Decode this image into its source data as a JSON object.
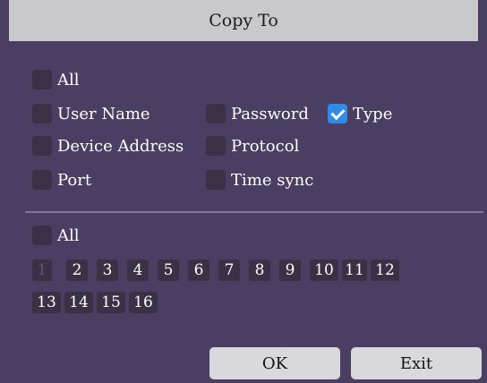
{
  "dialog": {
    "title": "Copy To"
  },
  "fields": {
    "all_label": "All",
    "user_name": "User Name",
    "password": "Password",
    "type": "Type",
    "device_address": "Device Address",
    "protocol": "Protocol",
    "port": "Port",
    "time_sync": "Time sync"
  },
  "channels": {
    "all_label": "All",
    "row1": [
      "1",
      "2",
      "3",
      "4",
      "5",
      "6",
      "7",
      "8",
      "9",
      "10",
      "11",
      "12"
    ],
    "row2": [
      "13",
      "14",
      "15",
      "16"
    ]
  },
  "buttons": {
    "ok": "OK",
    "exit": "Exit"
  },
  "colors": {
    "background": "#4a3f63",
    "titlebar": "#c9c9cd",
    "checkbox": "#3a3146",
    "checked": "#2f8be3"
  }
}
